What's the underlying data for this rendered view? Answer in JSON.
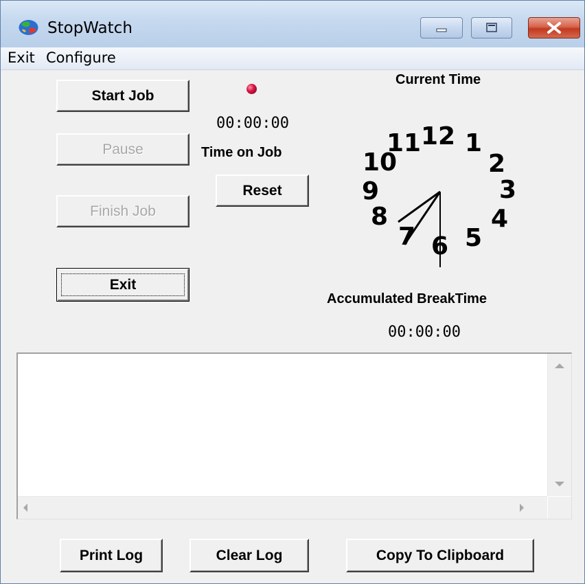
{
  "window": {
    "title": "StopWatch",
    "icon": "globe-app-icon",
    "controls": [
      "minimize-icon",
      "maximize-icon",
      "close-icon"
    ]
  },
  "menu": {
    "items": [
      "Exit",
      "Configure"
    ]
  },
  "buttons": {
    "start_job": "Start Job",
    "pause": "Pause",
    "finish_job": "Finish Job",
    "exit": "Exit",
    "reset": "Reset",
    "print_log": "Print Log",
    "clear_log": "Clear Log",
    "copy_to_clipboard": "Copy To Clipboard"
  },
  "status": {
    "indicator_color": "#d61646",
    "job_time": "00:00:00",
    "job_time_label": "Time on Job",
    "current_time_label": "Current Time",
    "break_time_label": "Accumulated BreakTime",
    "break_time": "00:00:00"
  },
  "clock": {
    "numerals": [
      "12",
      "1",
      "2",
      "3",
      "4",
      "5",
      "6",
      "7",
      "8",
      "9",
      "10",
      "11"
    ],
    "hour_hand_points_to": "8",
    "minute_hand_points_to": "7",
    "second_hand_points_to": "6"
  },
  "log": {
    "content": ""
  },
  "colors": {
    "face": "#f0f0f0",
    "close_button": "#c23a1f",
    "titlebar": "#c6d9ef"
  }
}
